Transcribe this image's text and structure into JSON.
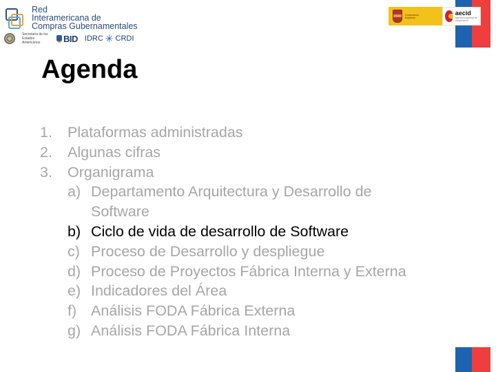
{
  "header": {
    "ricg_logo": {
      "line1": "Red",
      "line2": "Interamericana de",
      "line3": "Compras Gubernamentales"
    },
    "partners": {
      "oas_text": "Secretaría de los Estados Americanos",
      "bid": "BID",
      "idrc_left": "IDRC",
      "idrc_right": "CRDI"
    },
    "spain_logo_text": "Cooperación Española",
    "aecid": {
      "name": "aecid",
      "sub": "agencia española de cooperación"
    },
    "flag_colors": {
      "blue": "#1e63b0",
      "red": "#ee3e3e"
    }
  },
  "slide": {
    "title": "Agenda",
    "items": [
      {
        "num": "1.",
        "label": "Plataformas administradas"
      },
      {
        "num": "2.",
        "label": "Algunas cifras"
      },
      {
        "num": "3.",
        "label": "Organigrama"
      }
    ],
    "subitems": [
      {
        "num": "a)",
        "label": "Departamento Arquitectura y Desarrollo de Software",
        "active": false
      },
      {
        "num": "b)",
        "label": "Ciclo de vida de desarrollo de Software",
        "active": true
      },
      {
        "num": "c)",
        "label": "Proceso de Desarrollo y despliegue",
        "active": false
      },
      {
        "num": "d)",
        "label": "Proceso de Proyectos Fábrica Interna y Externa",
        "active": false
      },
      {
        "num": "e)",
        "label": "Indicadores del Área",
        "active": false
      },
      {
        "num": "f)",
        "label": "Análisis FODA Fábrica Externa",
        "active": false
      },
      {
        "num": "g)",
        "label": "Análisis FODA Fábrica Interna",
        "active": false
      }
    ],
    "colors": {
      "inactive_text": "#a6a6a6",
      "active_text": "#000000"
    }
  }
}
